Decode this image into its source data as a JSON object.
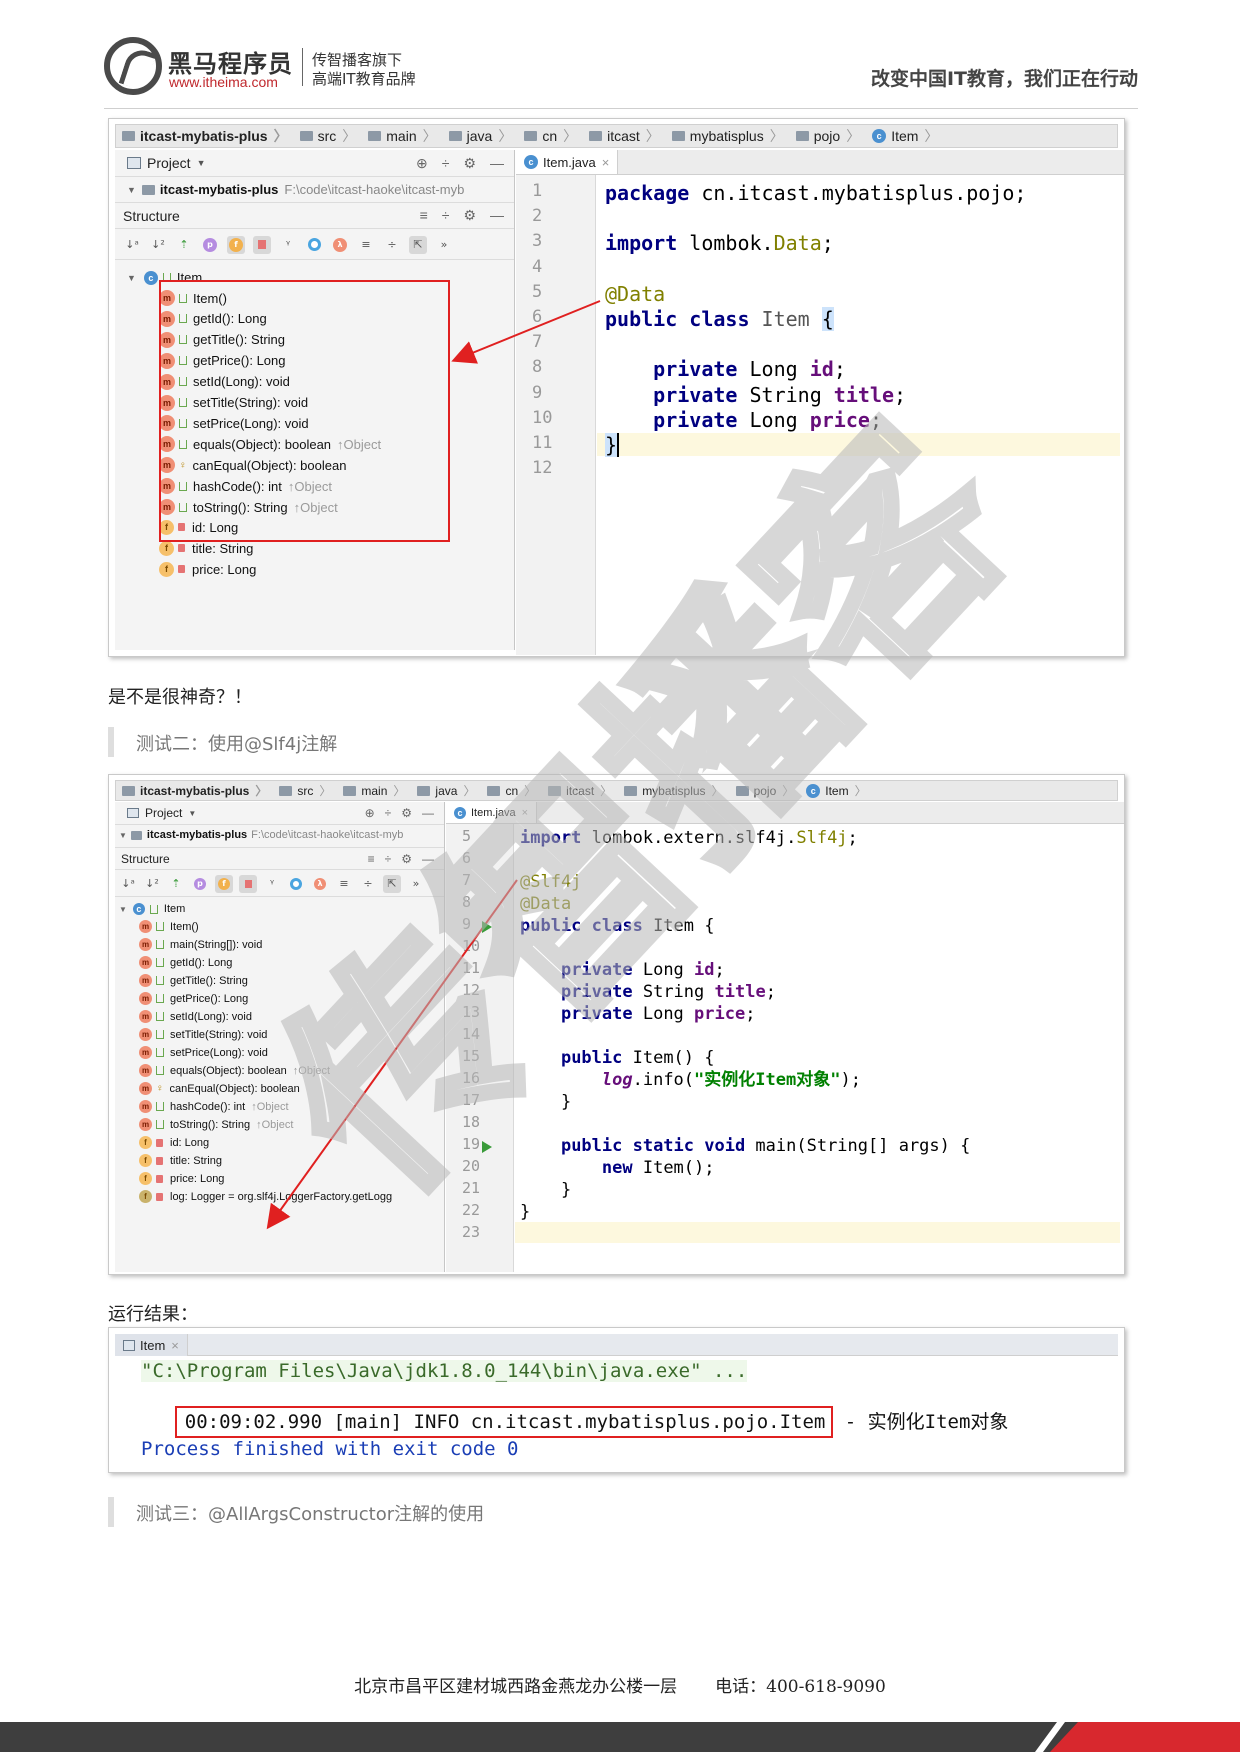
{
  "header": {
    "logo_name": "黑马程序员",
    "logo_url": "www.itheima.com",
    "logo_tag1": "传智播客旗下",
    "logo_tag2": "高端IT教育品牌",
    "slogan": "改变中国IT教育，我们正在行动"
  },
  "shot1": {
    "breadcrumb": [
      "itcast-mybatis-plus",
      "src",
      "main",
      "java",
      "cn",
      "itcast",
      "mybatisplus",
      "pojo",
      "Item"
    ],
    "project_label": "Project",
    "project_root": "itcast-mybatis-plus",
    "project_path": "F:\\code\\itcast-haoke\\itcast-myb",
    "structure_label": "Structure",
    "tab": "Item.java",
    "tree_root": "Item",
    "members": [
      {
        "name": "Item()",
        "kind": "m",
        "vis": "pub",
        "ret": ""
      },
      {
        "name": "getId(): Long",
        "kind": "m",
        "vis": "pub",
        "ret": ""
      },
      {
        "name": "getTitle(): String",
        "kind": "m",
        "vis": "pub",
        "ret": ""
      },
      {
        "name": "getPrice(): Long",
        "kind": "m",
        "vis": "pub",
        "ret": ""
      },
      {
        "name": "setId(Long): void",
        "kind": "m",
        "vis": "pub",
        "ret": ""
      },
      {
        "name": "setTitle(String): void",
        "kind": "m",
        "vis": "pub",
        "ret": ""
      },
      {
        "name": "setPrice(Long): void",
        "kind": "m",
        "vis": "pub",
        "ret": ""
      },
      {
        "name": "equals(Object): boolean",
        "kind": "m",
        "vis": "pub",
        "ret": "↑Object"
      },
      {
        "name": "canEqual(Object): boolean",
        "kind": "m",
        "vis": "prot",
        "ret": ""
      },
      {
        "name": "hashCode(): int",
        "kind": "m",
        "vis": "pub",
        "ret": "↑Object"
      },
      {
        "name": "toString(): String",
        "kind": "m",
        "vis": "pub",
        "ret": "↑Object"
      },
      {
        "name": "id: Long",
        "kind": "f",
        "vis": "priv",
        "ret": ""
      },
      {
        "name": "title: String",
        "kind": "f",
        "vis": "priv",
        "ret": ""
      },
      {
        "name": "price: Long",
        "kind": "f",
        "vis": "priv",
        "ret": ""
      }
    ],
    "line_numbers": [
      "1",
      "2",
      "3",
      "4",
      "5",
      "6",
      "7",
      "8",
      "9",
      "10",
      "11",
      "12"
    ]
  },
  "para1": "是不是很神奇？！",
  "quote1": "测试二：使用@Slf4j注解",
  "shot2": {
    "breadcrumb": [
      "itcast-mybatis-plus",
      "src",
      "main",
      "java",
      "cn",
      "itcast",
      "mybatisplus",
      "pojo",
      "Item"
    ],
    "project_label": "Project",
    "project_root": "itcast-mybatis-plus",
    "project_path": "F:\\code\\itcast-haoke\\itcast-myb",
    "structure_label": "Structure",
    "tab": "Item.java",
    "tree_root": "Item",
    "members": [
      {
        "name": "Item()",
        "kind": "m",
        "vis": "pub",
        "ret": ""
      },
      {
        "name": "main(String[]): void",
        "kind": "m",
        "vis": "pub",
        "ret": ""
      },
      {
        "name": "getId(): Long",
        "kind": "m",
        "vis": "pub",
        "ret": ""
      },
      {
        "name": "getTitle(): String",
        "kind": "m",
        "vis": "pub",
        "ret": ""
      },
      {
        "name": "getPrice(): Long",
        "kind": "m",
        "vis": "pub",
        "ret": ""
      },
      {
        "name": "setId(Long): void",
        "kind": "m",
        "vis": "pub",
        "ret": ""
      },
      {
        "name": "setTitle(String): void",
        "kind": "m",
        "vis": "pub",
        "ret": ""
      },
      {
        "name": "setPrice(Long): void",
        "kind": "m",
        "vis": "pub",
        "ret": ""
      },
      {
        "name": "equals(Object): boolean",
        "kind": "m",
        "vis": "pub",
        "ret": "↑Object"
      },
      {
        "name": "canEqual(Object): boolean",
        "kind": "m",
        "vis": "prot",
        "ret": ""
      },
      {
        "name": "hashCode(): int",
        "kind": "m",
        "vis": "pub",
        "ret": "↑Object"
      },
      {
        "name": "toString(): String",
        "kind": "m",
        "vis": "pub",
        "ret": "↑Object"
      },
      {
        "name": "id: Long",
        "kind": "f",
        "vis": "priv",
        "ret": ""
      },
      {
        "name": "title: String",
        "kind": "f",
        "vis": "priv",
        "ret": ""
      },
      {
        "name": "price: Long",
        "kind": "f",
        "vis": "priv",
        "ret": ""
      },
      {
        "name": "log: Logger = org.slf4j.LoggerFactory.getLogg",
        "kind": "s",
        "vis": "priv",
        "ret": ""
      }
    ],
    "line_numbers": [
      "5",
      "6",
      "7",
      "8",
      "9",
      "10",
      "11",
      "12",
      "13",
      "14",
      "15",
      "16",
      "17",
      "18",
      "19",
      "20",
      "21",
      "22",
      "23"
    ]
  },
  "para2": "运行结果：",
  "console": {
    "tab": "Item",
    "line1": "\"C:\\Program Files\\Java\\jdk1.8.0_144\\bin\\java.exe\" ...",
    "line2": "00:09:02.990 [main] INFO cn.itcast.mybatisplus.pojo.Item",
    "line2_tail": " - 实例化Item对象",
    "line3": "Process finished with exit code 0"
  },
  "quote2": "测试三：@AllArgsConstructor注解的使用",
  "footer": {
    "address": "北京市昌平区建材城西路金燕龙办公楼一层",
    "phone": "电话：400-618-9090"
  },
  "watermark_text": "传智播客",
  "colors": {
    "keyword": "#000080",
    "annotation": "#808000",
    "field": "#660e7a",
    "string": "#008000",
    "highlight_box": "#e02020",
    "brand_red": "#c0282d"
  }
}
